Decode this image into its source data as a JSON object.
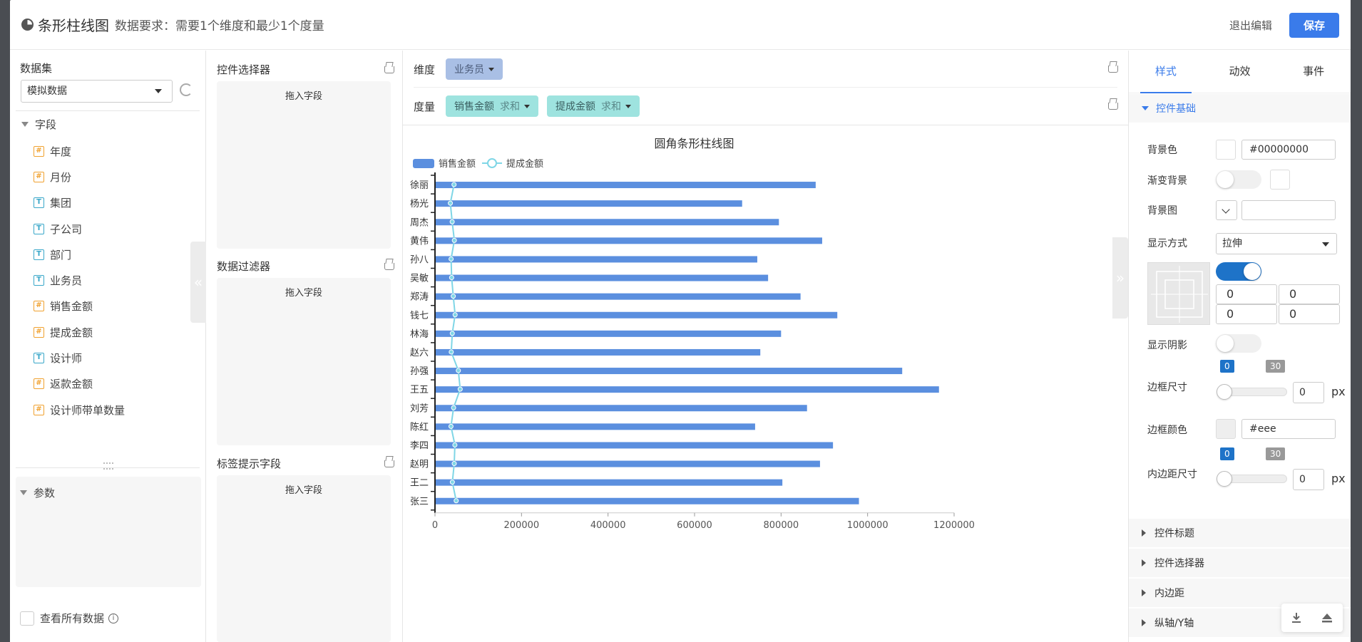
{
  "header": {
    "title": "条形柱线图",
    "requirement": "数据要求：需要1个维度和最少1个度量",
    "exit_label": "退出编辑",
    "save_label": "保存"
  },
  "dataset_panel": {
    "label": "数据集",
    "selected": "模拟数据",
    "fields_label": "字段",
    "fields": [
      {
        "name": "年度",
        "type": "number"
      },
      {
        "name": "月份",
        "type": "number"
      },
      {
        "name": "集团",
        "type": "text"
      },
      {
        "name": "子公司",
        "type": "text"
      },
      {
        "name": "部门",
        "type": "text"
      },
      {
        "name": "业务员",
        "type": "text"
      },
      {
        "name": "销售金额",
        "type": "number"
      },
      {
        "name": "提成金额",
        "type": "number"
      },
      {
        "name": "设计师",
        "type": "text"
      },
      {
        "name": "返款金额",
        "type": "number"
      },
      {
        "name": "设计师带单数量",
        "type": "number"
      }
    ],
    "params_label": "参数",
    "view_all_label": "查看所有数据"
  },
  "zones": {
    "selector_label": "控件选择器",
    "filter_label": "数据过滤器",
    "tooltip_label": "标签提示字段",
    "drop_text": "拖入字段"
  },
  "shelves": {
    "dimension_label": "维度",
    "dimension_pill": "业务员",
    "measure_label": "度量",
    "measures": [
      {
        "name": "销售金额",
        "agg": "求和"
      },
      {
        "name": "提成金额",
        "agg": "求和"
      }
    ]
  },
  "chart_data": {
    "type": "bar",
    "title": "圆角条形柱线图",
    "categories": [
      "徐丽",
      "杨光",
      "周杰",
      "黄伟",
      "孙八",
      "吴敏",
      "郑涛",
      "钱七",
      "林海",
      "赵六",
      "孙强",
      "王五",
      "刘芳",
      "陈红",
      "李四",
      "赵明",
      "王二",
      "张三"
    ],
    "series": [
      {
        "name": "销售金额",
        "kind": "bar",
        "color": "#5b8fdf",
        "values": [
          880000,
          710000,
          795000,
          895000,
          745000,
          770000,
          845000,
          930000,
          800000,
          752000,
          1080000,
          1165000,
          860000,
          740000,
          920000,
          890000,
          803000,
          980000
        ]
      },
      {
        "name": "提成金额",
        "kind": "line",
        "color": "#7fd6e6",
        "values": [
          44000,
          35500,
          39750,
          44750,
          37250,
          38500,
          42250,
          46500,
          40000,
          37600,
          54000,
          58250,
          43000,
          37000,
          46000,
          44500,
          40150,
          49000
        ]
      }
    ],
    "xticks": [
      "0",
      "200000",
      "400000",
      "600000",
      "800000",
      "1000000",
      "1200000"
    ],
    "xlim": [
      0,
      1200000
    ],
    "legend_position": "top-left"
  },
  "props": {
    "tabs": [
      "样式",
      "动效",
      "事件"
    ],
    "active_tab": 0,
    "basic_section": "控件基础",
    "bg_color_label": "背景色",
    "bg_color_value": "#00000000",
    "gradient_label": "渐变背景",
    "bg_image_label": "背景图",
    "display_mode_label": "显示方式",
    "display_mode_value": "拉伸",
    "pos_values": [
      "0",
      "0",
      "0",
      "0"
    ],
    "shadow_label": "显示阴影",
    "badge_min": "0",
    "badge_max": "30",
    "border_size_label": "边框尺寸",
    "border_size_value": "0",
    "px": "px",
    "border_color_label": "边框颜色",
    "border_color_value": "#eee",
    "padding_label": "内边距尺寸",
    "padding_value": "0",
    "sections": [
      "控件标题",
      "控件选择器",
      "内边距",
      "纵轴/Y轴"
    ]
  }
}
